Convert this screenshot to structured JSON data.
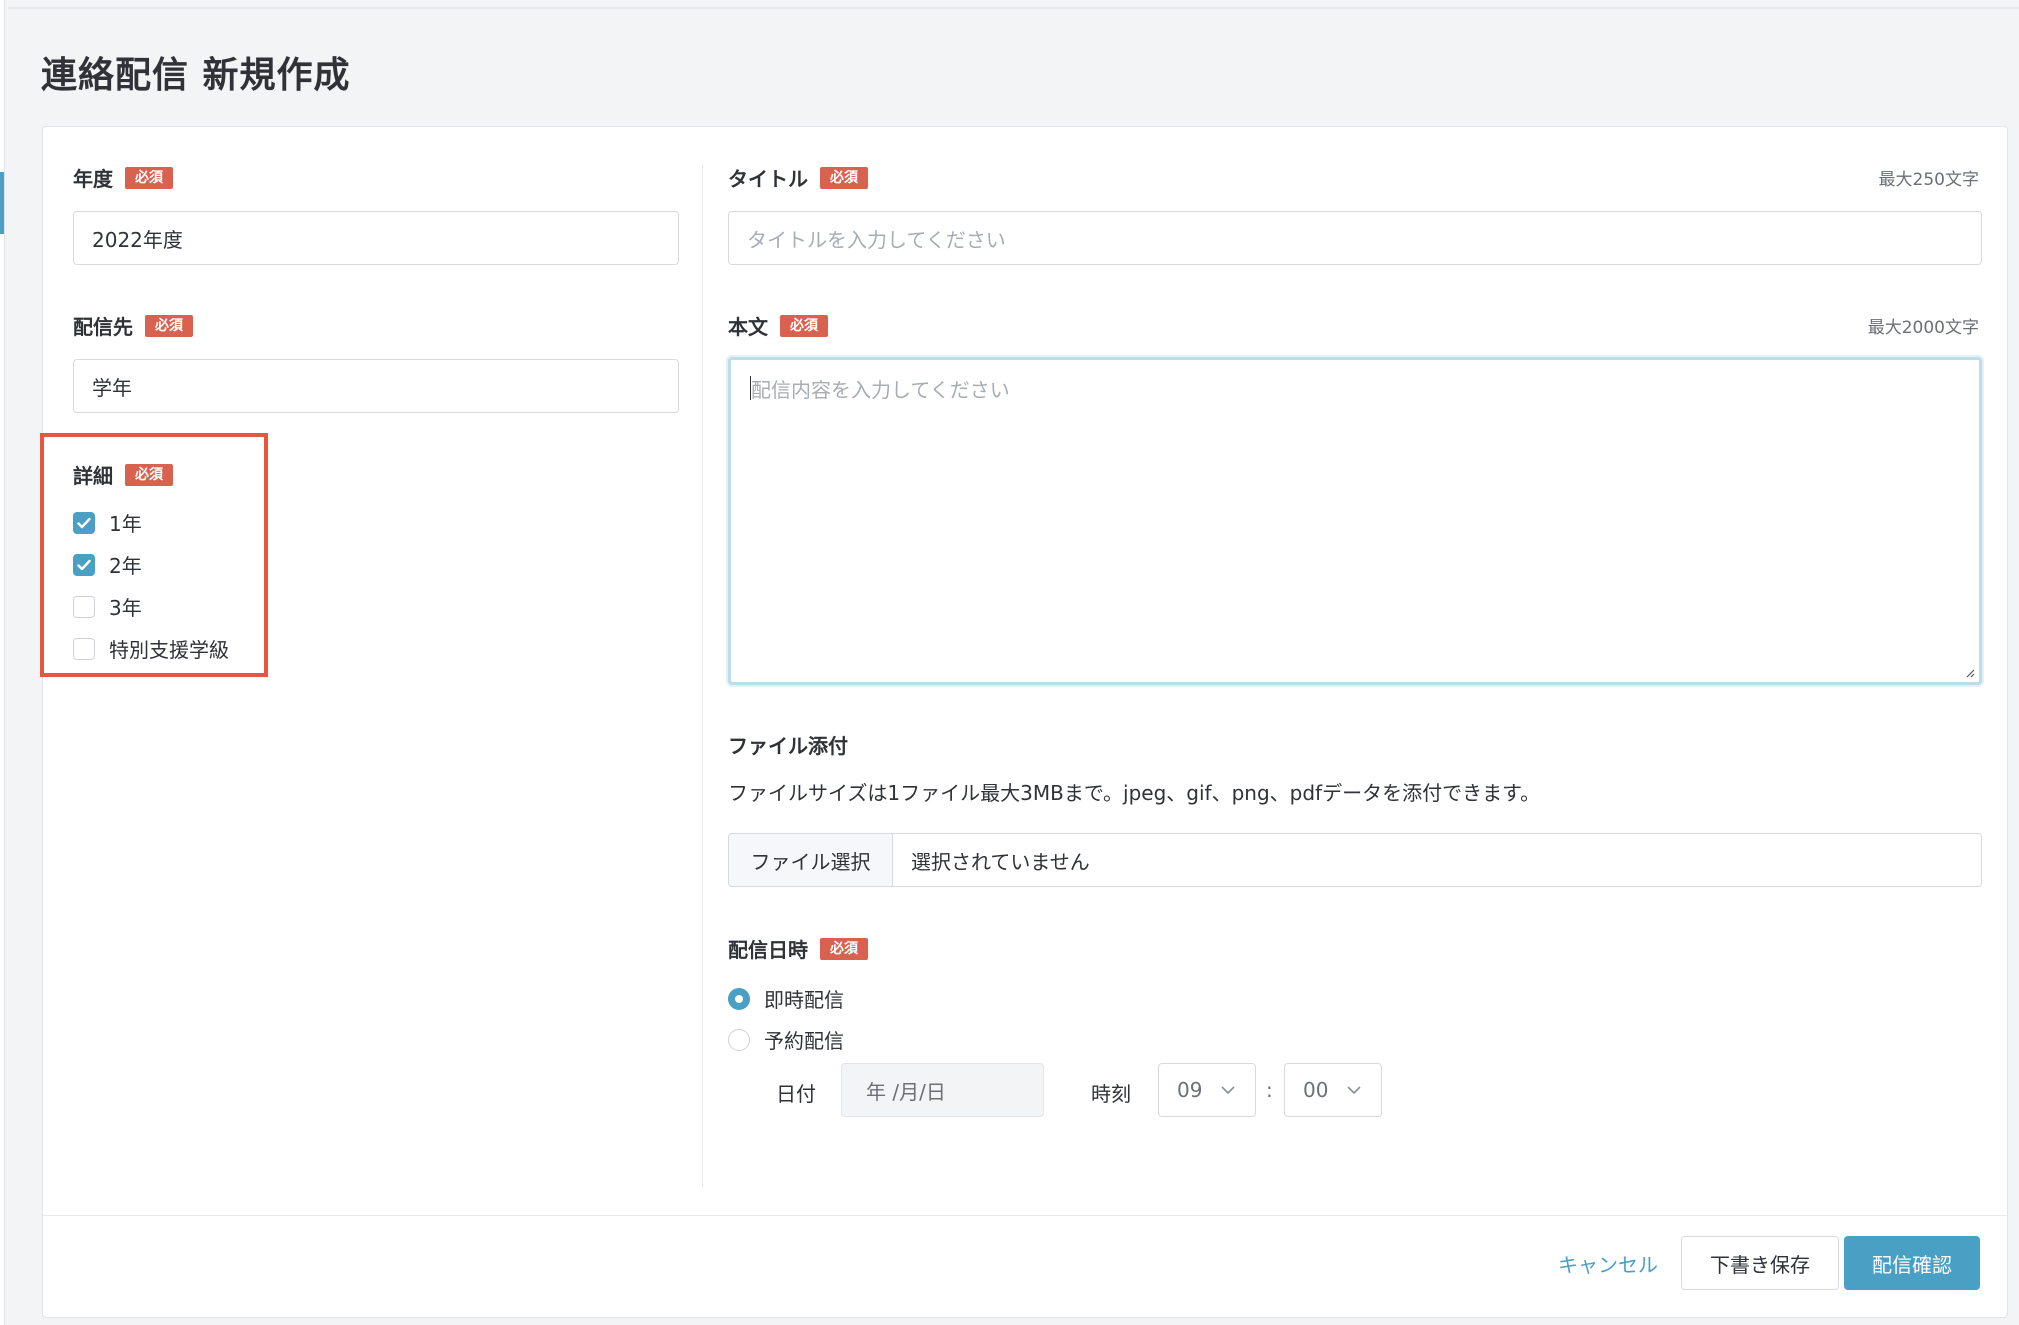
{
  "page": {
    "title": "連絡配信 新規作成"
  },
  "required_badge": "必須",
  "fiscal_year": {
    "label": "年度",
    "value": "2022年度"
  },
  "destination": {
    "label": "配信先",
    "value": "学年"
  },
  "details": {
    "label": "詳細",
    "options": [
      {
        "label": "1年",
        "checked": true
      },
      {
        "label": "2年",
        "checked": true
      },
      {
        "label": "3年",
        "checked": false
      },
      {
        "label": "特別支援学級",
        "checked": false
      }
    ]
  },
  "title_field": {
    "label": "タイトル",
    "limit": "最大250文字",
    "placeholder": "タイトルを入力してください"
  },
  "body_field": {
    "label": "本文",
    "limit": "最大2000文字",
    "placeholder": "配信内容を入力してください"
  },
  "attachment": {
    "label": "ファイル添付",
    "description": "ファイルサイズは1ファイル最大3MBまで。jpeg、gif、png、pdfデータを添付できます。",
    "button": "ファイル選択",
    "status": "選択されていません"
  },
  "schedule": {
    "label": "配信日時",
    "options": [
      {
        "label": "即時配信",
        "selected": true
      },
      {
        "label": "予約配信",
        "selected": false
      }
    ],
    "date_label": "日付",
    "date_placeholder": "年 /月/日",
    "time_label": "時刻",
    "hour": "09",
    "separator": ":",
    "minute": "00"
  },
  "actions": {
    "cancel": "キャンセル",
    "draft": "下書き保存",
    "confirm": "配信確認"
  },
  "colors": {
    "accent": "#4a9fc4",
    "required": "#d9614f",
    "highlight": "#e2593f"
  }
}
